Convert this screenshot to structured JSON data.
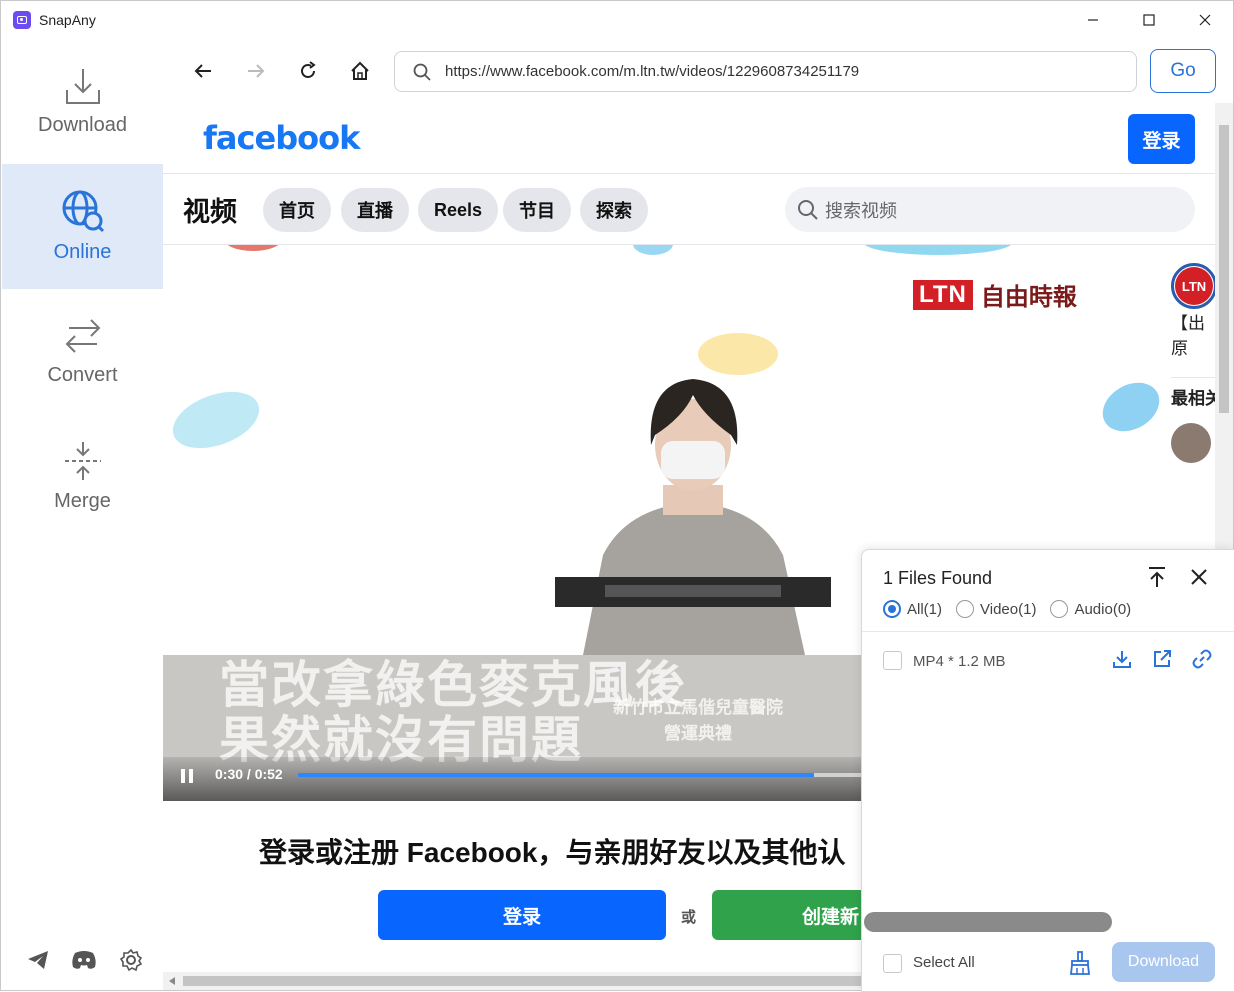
{
  "app": {
    "title": "SnapAny",
    "window_controls": [
      "minimize-icon",
      "maximize-icon",
      "close-icon"
    ]
  },
  "sidebar": {
    "items": [
      {
        "label": "Download",
        "icon": "download-icon",
        "active": false
      },
      {
        "label": "Online",
        "icon": "globe-search-icon",
        "active": true
      },
      {
        "label": "Convert",
        "icon": "swap-arrows-icon",
        "active": false
      },
      {
        "label": "Merge",
        "icon": "merge-icon",
        "active": false
      }
    ],
    "footer_icons": [
      "telegram-icon",
      "discord-icon",
      "gear-icon"
    ]
  },
  "browser": {
    "url": "https://www.facebook.com/m.ltn.tw/videos/1229608734251179",
    "go_label": "Go",
    "nav_icons": [
      "back-arrow-icon",
      "forward-arrow-icon",
      "reload-icon",
      "home-icon"
    ]
  },
  "page": {
    "logo": "facebook",
    "login_label": "登录",
    "nav_title": "视频",
    "tabs": [
      "首页",
      "直播",
      "Reels",
      "节目",
      "探索"
    ],
    "search_placeholder": "搜索视频",
    "video": {
      "channel_box": "LTN",
      "channel_text": "自由時報",
      "caption_line1": "當改拿綠色麥克風後",
      "caption_line2": "果然就沒有問題",
      "caption_small": "新竹市立馬偕兒童醫院\n營運典禮",
      "time": "0:30 / 0:52",
      "progress": 0.6
    },
    "side": {
      "avatar_text": "LTN",
      "title_partial": "【出原\n害】...",
      "related_partial": "最相关"
    },
    "signup_text": "登录或注册 Facebook，与亲朋好友以及其他认",
    "login_button": "登录",
    "or": "或",
    "create_button": "创建新"
  },
  "panel": {
    "title": "1 Files Found",
    "filters": [
      {
        "label": "All(1)",
        "checked": true
      },
      {
        "label": "Video(1)",
        "checked": false
      },
      {
        "label": "Audio(0)",
        "checked": false
      }
    ],
    "files": [
      {
        "label": "MP4 * 1.2 MB"
      }
    ],
    "select_all": "Select All",
    "download": "Download"
  },
  "colors": {
    "accent": "#2a73d9",
    "facebook_blue": "#1877f2",
    "fb_button": "#0866ff",
    "create_green": "#31a24c",
    "ltn_red": "#d32027"
  }
}
